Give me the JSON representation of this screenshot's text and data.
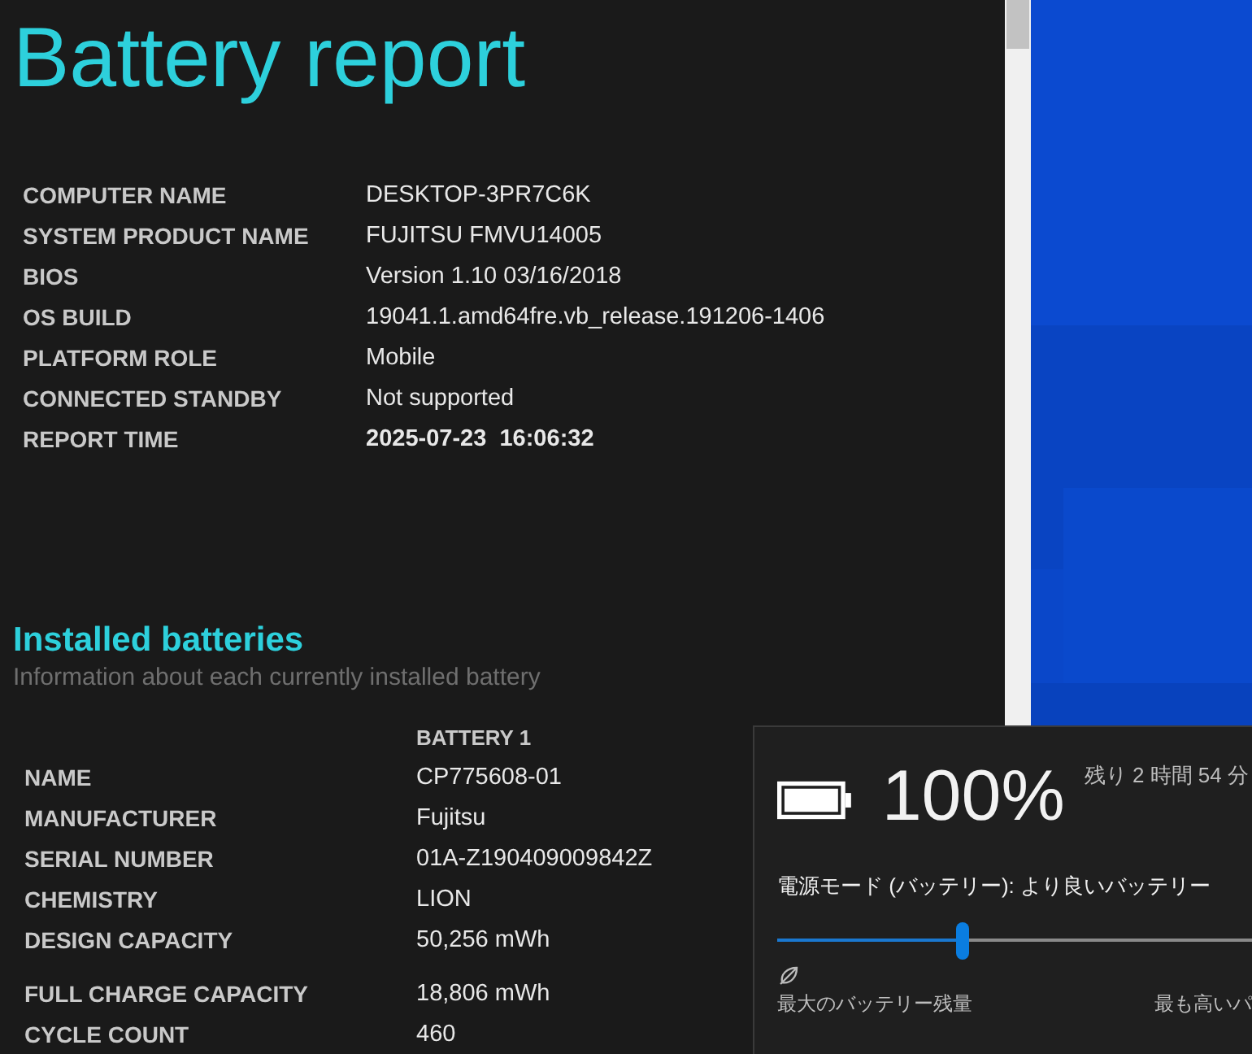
{
  "report": {
    "title": "Battery report",
    "system_info": [
      {
        "label": "COMPUTER NAME",
        "value": "DESKTOP-3PR7C6K"
      },
      {
        "label": "SYSTEM PRODUCT NAME",
        "value": "FUJITSU FMVU14005"
      },
      {
        "label": "BIOS",
        "value": "Version 1.10 03/16/2018"
      },
      {
        "label": "OS BUILD",
        "value": "19041.1.amd64fre.vb_release.191206-1406"
      },
      {
        "label": "PLATFORM ROLE",
        "value": "Mobile"
      },
      {
        "label": "CONNECTED STANDBY",
        "value": "Not supported"
      },
      {
        "label": "REPORT TIME",
        "value": "2025-07-23  16:06:32",
        "bold": true
      }
    ],
    "installed_batteries": {
      "heading": "Installed batteries",
      "subtitle": "Information about each currently installed battery",
      "column": "BATTERY 1",
      "rows": [
        {
          "label": "NAME",
          "value": "CP775608-01"
        },
        {
          "label": "MANUFACTURER",
          "value": "Fujitsu"
        },
        {
          "label": "SERIAL NUMBER",
          "value": "01A-Z190409009842Z"
        },
        {
          "label": "CHEMISTRY",
          "value": "LION"
        },
        {
          "label": "DESIGN CAPACITY",
          "value": "50,256 mWh"
        },
        {
          "label": "FULL CHARGE CAPACITY",
          "value": "18,806 mWh"
        },
        {
          "label": "CYCLE COUNT",
          "value": "460"
        }
      ]
    }
  },
  "battery_flyout": {
    "percent": "100%",
    "remaining": "残り 2 時間 54 分",
    "power_mode": "電源モード (バッテリー): より良いバッテリー",
    "slider": {
      "level": 0.38
    },
    "left_label": "最大のバッテリー残量",
    "right_label": "最も高いパ"
  }
}
